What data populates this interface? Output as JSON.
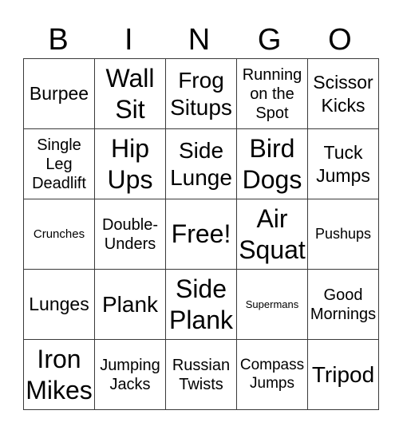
{
  "header": {
    "letters": [
      "B",
      "I",
      "N",
      "G",
      "O"
    ]
  },
  "card": {
    "rows": [
      [
        {
          "text": "Burpee",
          "size": "m"
        },
        {
          "text": "Wall Sit",
          "size": "xl"
        },
        {
          "text": "Frog Situps",
          "size": "l"
        },
        {
          "text": "Running on the Spot",
          "size": "s"
        },
        {
          "text": "Scissor Kicks",
          "size": "m"
        }
      ],
      [
        {
          "text": "Single Leg Deadlift",
          "size": "s"
        },
        {
          "text": "Hip Ups",
          "size": "xl"
        },
        {
          "text": "Side Lunge",
          "size": "l"
        },
        {
          "text": "Bird Dogs",
          "size": "xl"
        },
        {
          "text": "Tuck Jumps",
          "size": "m"
        }
      ],
      [
        {
          "text": "Crunches",
          "size": "xs"
        },
        {
          "text": "Double-Unders",
          "size": "s"
        },
        {
          "text": "Free!",
          "size": "xl"
        },
        {
          "text": "Air Squat",
          "size": "xl"
        },
        {
          "text": "Pushups",
          "size": "xs2"
        }
      ],
      [
        {
          "text": "Lunges",
          "size": "m"
        },
        {
          "text": "Plank",
          "size": "l"
        },
        {
          "text": "Side Plank",
          "size": "xl"
        },
        {
          "text": "Supermans",
          "size": "xxs"
        },
        {
          "text": "Good Mornings",
          "size": "s"
        }
      ],
      [
        {
          "text": "Iron Mikes",
          "size": "xl"
        },
        {
          "text": "Jumping Jacks",
          "size": "s"
        },
        {
          "text": "Russian Twists",
          "size": "s"
        },
        {
          "text": "Compass Jumps",
          "size": "s2"
        },
        {
          "text": "Tripod",
          "size": "l"
        }
      ]
    ]
  }
}
